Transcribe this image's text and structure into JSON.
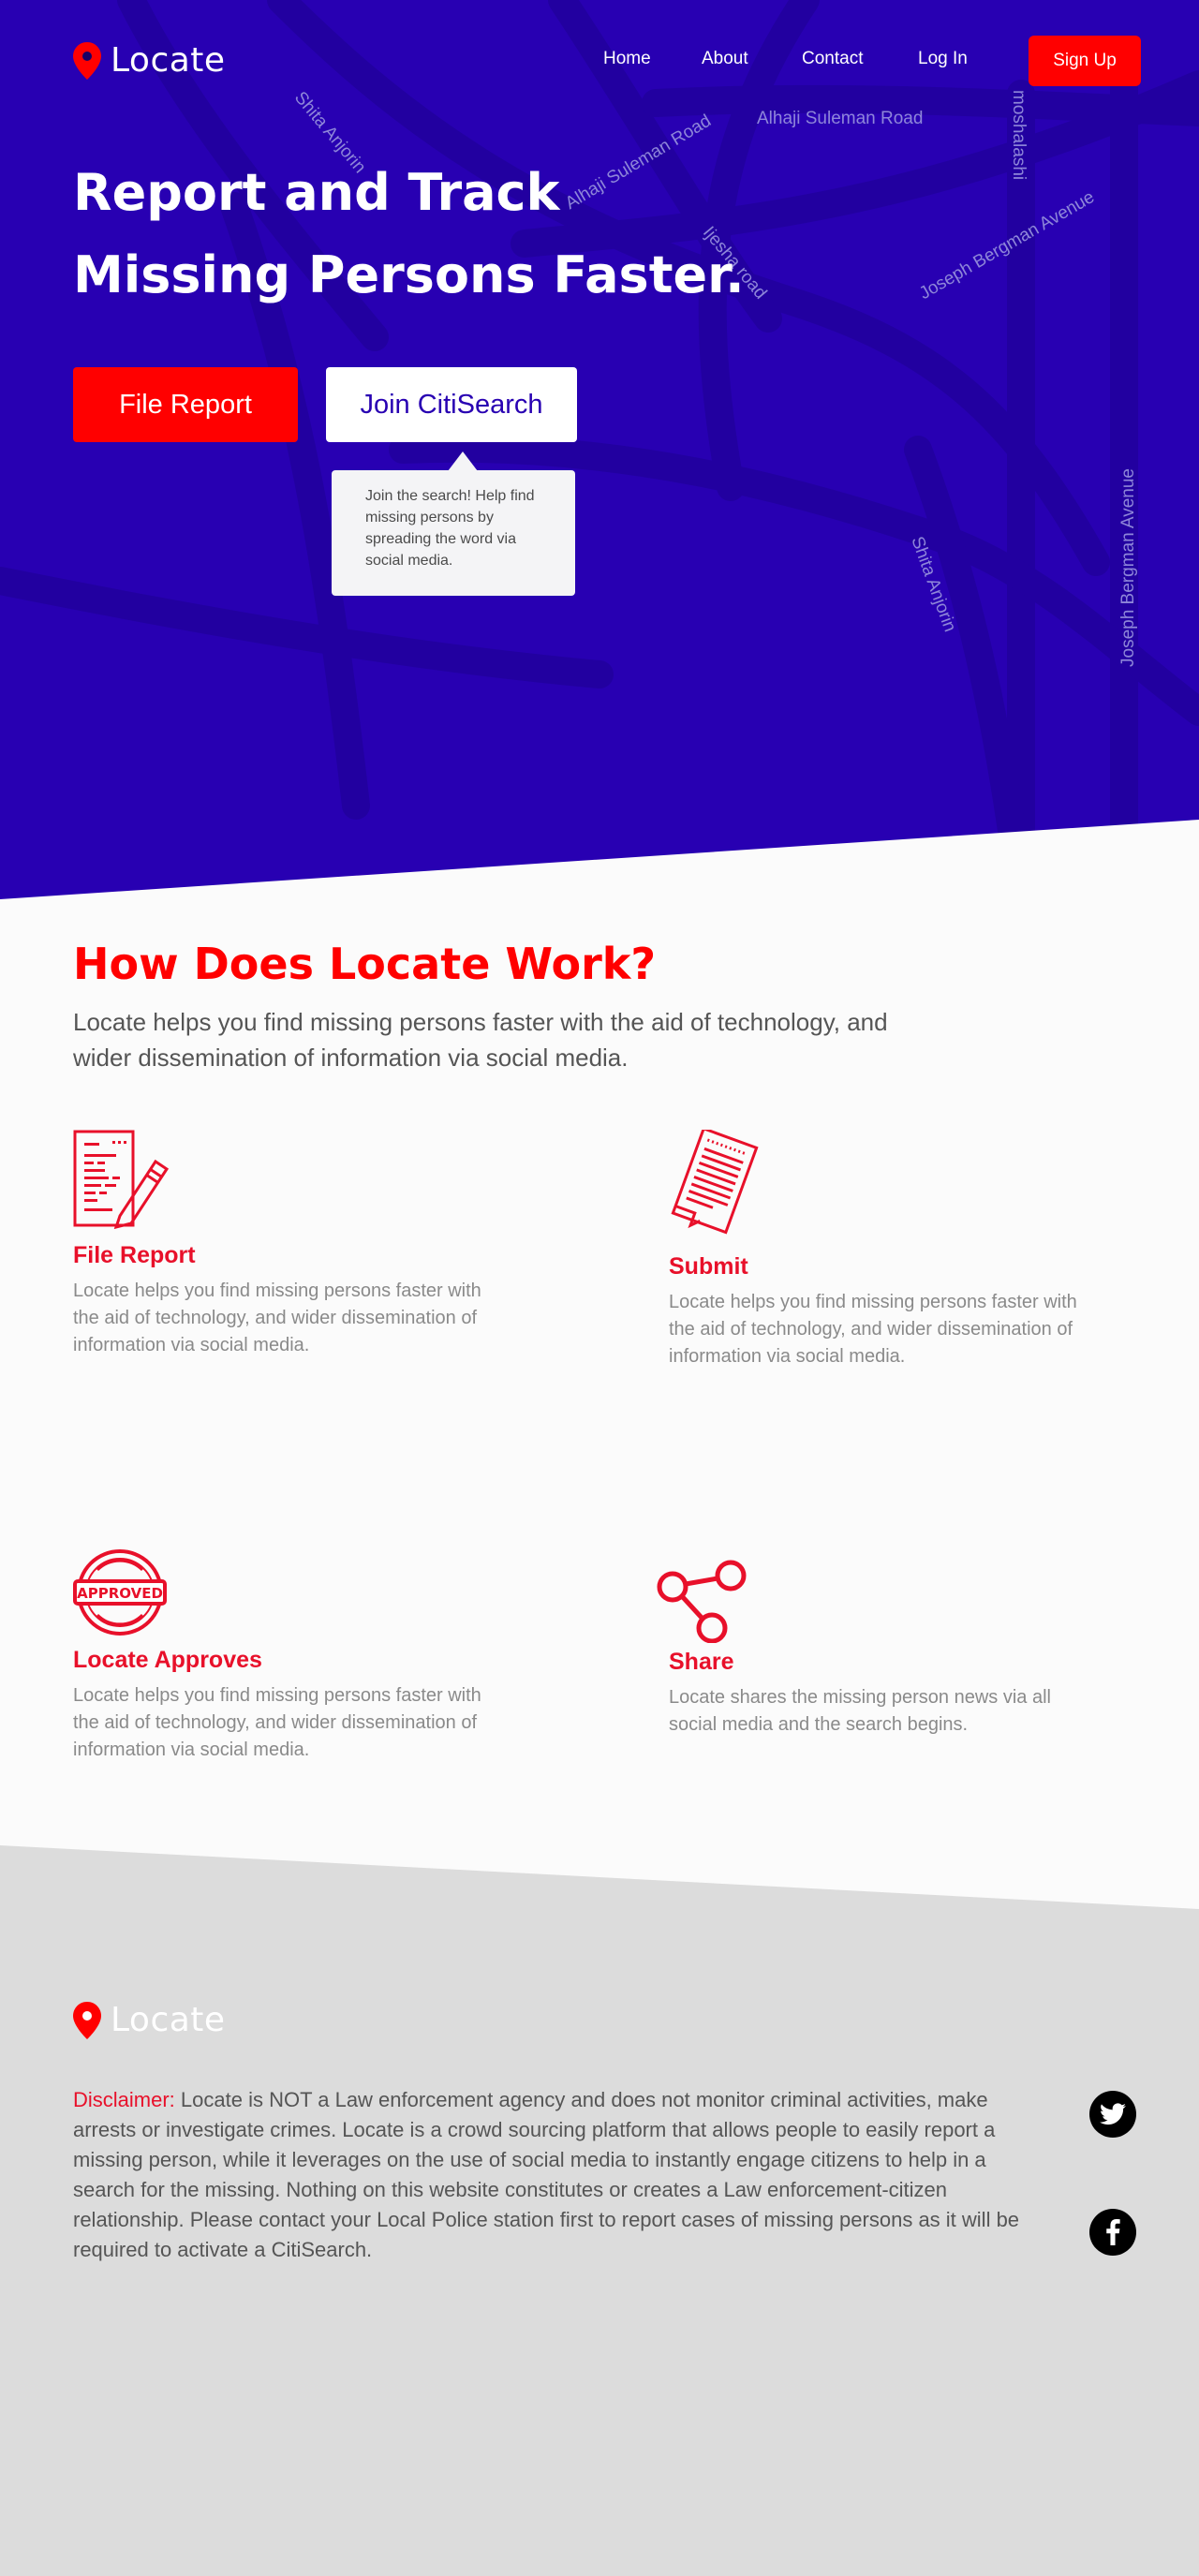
{
  "brand": {
    "name": "Locate",
    "accent": "#ff0000",
    "hero_bg": "#2800b2"
  },
  "nav": {
    "home": "Home",
    "about": "About",
    "contact": "Contact",
    "login": "Log In",
    "signup": "Sign Up"
  },
  "hero": {
    "title_line1": "Report and Track",
    "title_line2": "Missing Persons Faster.",
    "file_report": "File Report",
    "join": "Join CitiSearch",
    "tooltip": "Join the search! Help find missing persons by spreading the word via social media."
  },
  "map_labels": {
    "shita_1": "Shita Anjorin",
    "alhaji_1": "Alhaji Suleman Road",
    "alhaji_2": "Alhaji Suleman Road",
    "moshalashi": "moshalashi",
    "joseph_1": "Joseph Bergman Avenue",
    "ijesha": "Ijesha road",
    "shita_2": "Shita Anjorin",
    "joseph_2": "Joseph Bergman Avenue"
  },
  "how": {
    "title": "How Does Locate Work?",
    "subtitle": "Locate helps you find missing persons faster with the aid of technology, and wider dissemination of information via social media.",
    "steps": [
      {
        "icon": "file-report-icon",
        "title": "File Report",
        "text": "Locate helps you find missing persons faster with the aid of technology, and wider dissemination of information via social media."
      },
      {
        "icon": "submit-document-icon",
        "title": "Submit",
        "text": "Locate helps you find missing persons faster with the aid of technology, and wider dissemination of information via social media."
      },
      {
        "icon": "approved-stamp-icon",
        "title": "Locate Approves",
        "text": "Locate helps you find missing persons faster with the aid of technology, and wider dissemination of information via social media.",
        "stamp_text": "APPROVED"
      },
      {
        "icon": "share-icon",
        "title": "Share",
        "text": "Locate shares the missing person news via all social media and the search begins."
      }
    ]
  },
  "footer": {
    "logo": "Locate",
    "disclaimer_label": "Disclaimer:",
    "disclaimer_text": "Locate is NOT a Law enforcement agency and does not monitor criminal activities, make arrests or investigate crimes. Locate is a crowd sourcing platform that allows people to easily report a missing person, while it leverages on the use of social media to instantly engage citizens to help in a search for the missing. Nothing on this website constitutes or creates a Law enforcement-citizen relationship. Please contact your Local Police station first to report cases of missing persons as it will be required to activate a CitiSearch.",
    "social": [
      "twitter-icon",
      "facebook-icon"
    ]
  }
}
